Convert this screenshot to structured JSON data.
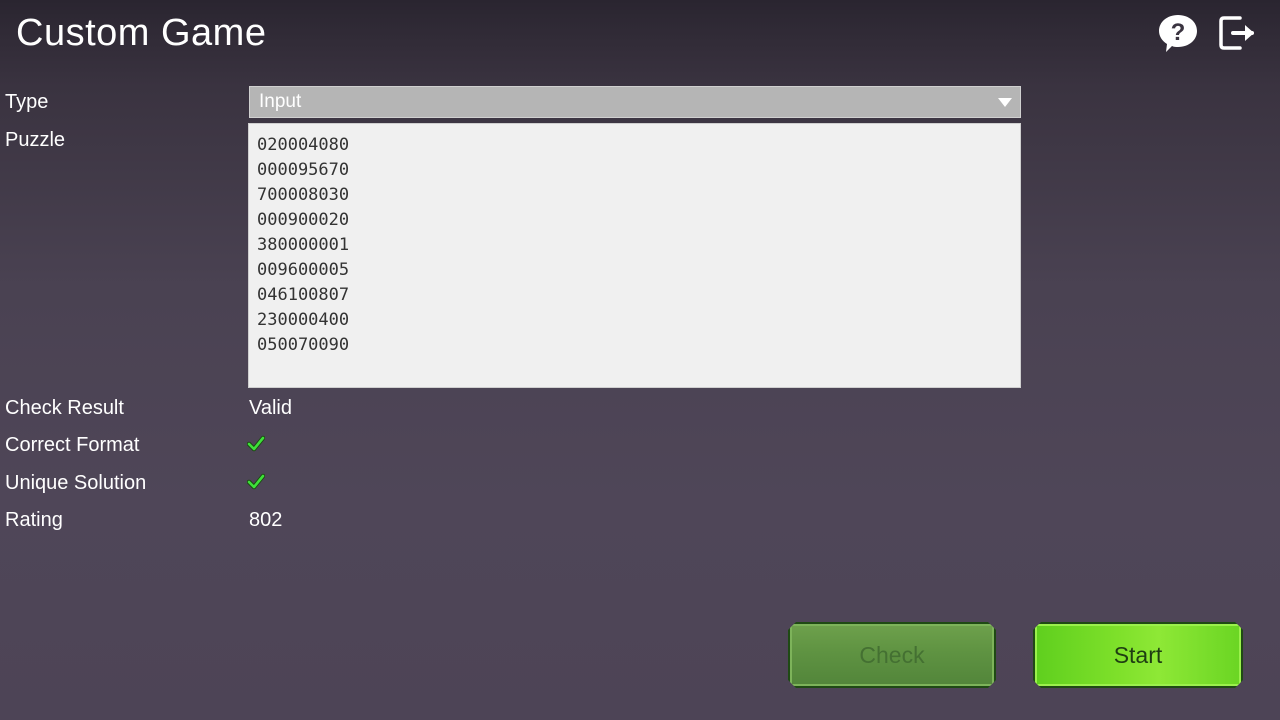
{
  "header": {
    "title": "Custom Game",
    "icons": [
      "help-icon",
      "exit-icon"
    ]
  },
  "form": {
    "type_label": "Type",
    "type_value": "Input",
    "puzzle_label": "Puzzle",
    "puzzle_value": "020004080\n000095670\n700008030\n000900020\n380000001\n009600005\n046100807\n230000400\n050070090",
    "check_result_label": "Check Result",
    "check_result_value": "Valid",
    "correct_format_label": "Correct Format",
    "correct_format_ok": true,
    "unique_solution_label": "Unique Solution",
    "unique_solution_ok": true,
    "rating_label": "Rating",
    "rating_value": "802"
  },
  "buttons": {
    "check_label": "Check",
    "start_label": "Start"
  },
  "colors": {
    "check_mark": "#3ee03a",
    "start_button": "#7ee02a",
    "check_button_disabled": "#5f9342"
  }
}
